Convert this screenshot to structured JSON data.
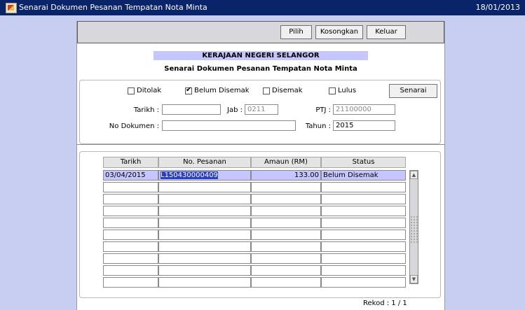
{
  "window": {
    "title": "Senarai Dokumen Pesanan Tempatan Nota Minta",
    "date": "18/01/2013"
  },
  "toolbar": {
    "pilih": "Pilih",
    "kosongkan": "Kosongkan",
    "keluar": "Keluar"
  },
  "header": {
    "org": "KERAJAAN NEGERI SELANGOR",
    "subtitle": "Senarai Dokumen Pesanan Tempatan Nota Minta"
  },
  "filters": {
    "checkboxes": [
      {
        "label": "Ditolak",
        "checked": false
      },
      {
        "label": "Belum Disemak",
        "checked": true
      },
      {
        "label": "Disemak",
        "checked": false
      },
      {
        "label": "Lulus",
        "checked": false
      }
    ],
    "senarai_button": "Senarai",
    "tarikh_label": "Tarikh :",
    "tarikh_value": "",
    "jab_label": "Jab :",
    "jab_value": "0211",
    "ptj_label": "PTJ :",
    "ptj_value": "21100000",
    "no_dokumen_label": "No Dokumen :",
    "no_dokumen_value": "",
    "tahun_label": "Tahun :",
    "tahun_value": "2015"
  },
  "table": {
    "headers": [
      "Tarikh",
      "No. Pesanan",
      "Amaun (RM)",
      "Status"
    ],
    "rows": [
      {
        "tarikh": "03/04/2015",
        "no_pesanan": "L150430000409",
        "amaun": "133.00",
        "status": "Belum Disemak"
      },
      {
        "tarikh": "",
        "no_pesanan": "",
        "amaun": "",
        "status": ""
      },
      {
        "tarikh": "",
        "no_pesanan": "",
        "amaun": "",
        "status": ""
      },
      {
        "tarikh": "",
        "no_pesanan": "",
        "amaun": "",
        "status": ""
      },
      {
        "tarikh": "",
        "no_pesanan": "",
        "amaun": "",
        "status": ""
      },
      {
        "tarikh": "",
        "no_pesanan": "",
        "amaun": "",
        "status": ""
      },
      {
        "tarikh": "",
        "no_pesanan": "",
        "amaun": "",
        "status": ""
      },
      {
        "tarikh": "",
        "no_pesanan": "",
        "amaun": "",
        "status": ""
      },
      {
        "tarikh": "",
        "no_pesanan": "",
        "amaun": "",
        "status": ""
      },
      {
        "tarikh": "",
        "no_pesanan": "",
        "amaun": "",
        "status": ""
      }
    ]
  },
  "footer": {
    "rekod": "Rekod : 1 / 1"
  },
  "icons": {
    "app": "oracle-forms-app-icon",
    "scroll_up": "arrow-up-icon",
    "scroll_down": "arrow-down-icon"
  }
}
